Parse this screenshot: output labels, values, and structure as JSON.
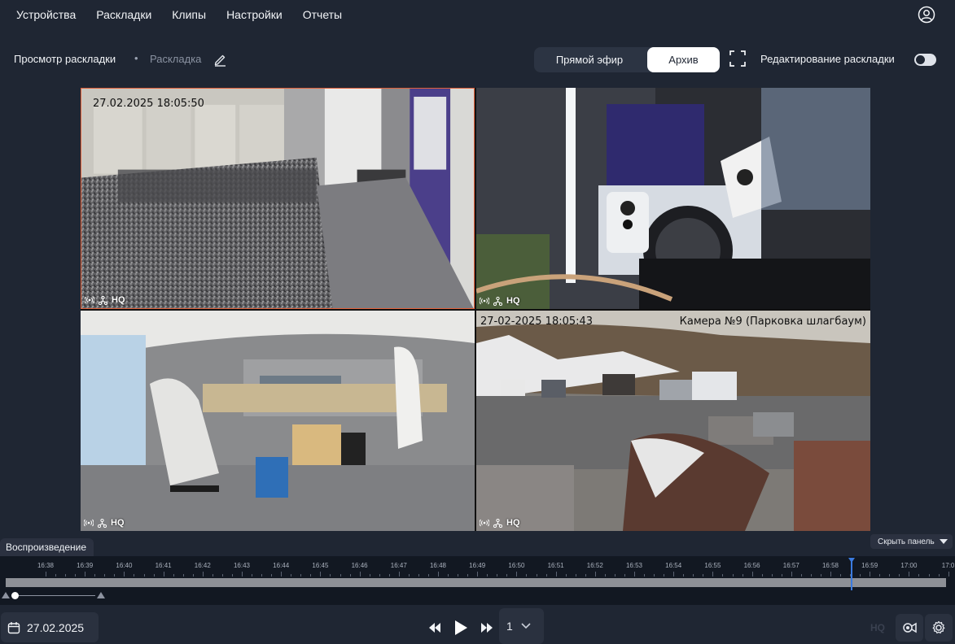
{
  "nav": {
    "items": [
      "Устройства",
      "Раскладки",
      "Клипы",
      "Настройки",
      "Отчеты"
    ],
    "user_icon": "user-circle-icon"
  },
  "header": {
    "title": "Просмотр раскладки",
    "separator": "•",
    "layout_name": "Раскладка",
    "edit_icon": "pencil-icon",
    "modes": {
      "live": "Прямой эфир",
      "archive": "Архив",
      "active": "archive"
    },
    "fullscreen_icon": "fullscreen-icon",
    "edit_layout_label": "Редактирование раскладки",
    "edit_layout_enabled": false
  },
  "cameras": [
    {
      "osd_time": "27.02.2025 18:05:50",
      "osd_name": "",
      "quality": "HQ",
      "selected": true
    },
    {
      "osd_time": "",
      "osd_name": "",
      "quality": "HQ",
      "selected": false
    },
    {
      "osd_time": "",
      "osd_name": "",
      "quality": "HQ",
      "selected": false
    },
    {
      "osd_time": "27-02-2025 18:05:43",
      "osd_name": "Камера №9 (Парковка шлагбаум)",
      "quality": "HQ",
      "selected": false
    }
  ],
  "playback": {
    "tab_label": "Воспроизведение",
    "hide_panel_label": "Скрыть панель",
    "ticks": [
      "16:38",
      "16:39",
      "16:40",
      "16:41",
      "16:42",
      "16:43",
      "16:44",
      "16:45",
      "16:46",
      "16:47",
      "16:48",
      "16:49",
      "16:50",
      "16:51",
      "16:52",
      "16:53",
      "16:54",
      "16:55",
      "16:56",
      "16:57",
      "16:58",
      "16:59",
      "17:00",
      "17:0"
    ],
    "cursor_time_fraction": 0.902
  },
  "controls": {
    "date": "27.02.2025",
    "speed": "1",
    "hq_label": "HQ",
    "accent": "#3b7be0"
  }
}
